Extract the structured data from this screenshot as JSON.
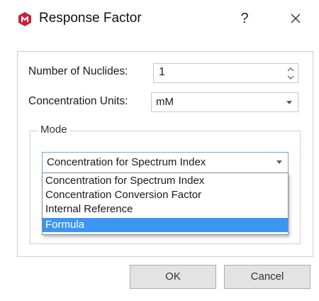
{
  "window": {
    "title": "Response Factor",
    "help_label": "?",
    "close_icon": "close-icon",
    "app_icon": "app-logo-icon",
    "accent_color": "#c8243a"
  },
  "form": {
    "nuclides_label": "Number of Nuclides:",
    "nuclides_value": "1",
    "units_label": "Concentration Units:",
    "units_value": "mM"
  },
  "mode": {
    "group_title": "Mode",
    "selected_value": "Concentration for Spectrum Index",
    "options": [
      "Concentration for Spectrum Index",
      "Concentration Conversion Factor",
      "Internal Reference",
      "Formula"
    ],
    "highlighted_option": "Formula",
    "highlight_color": "#3d95f2"
  },
  "buttons": {
    "ok": "OK",
    "cancel": "Cancel"
  }
}
